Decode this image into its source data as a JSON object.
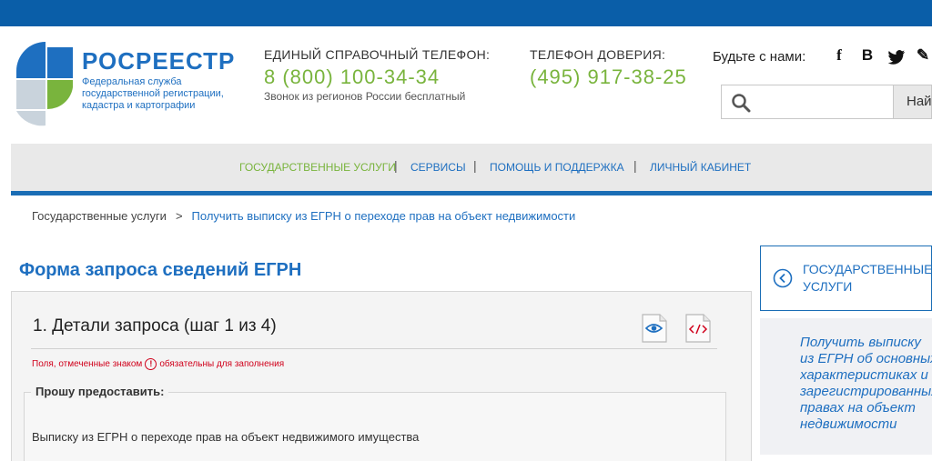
{
  "brand": {
    "title": "РОСРЕЕСТР",
    "subtitle_lines": [
      "Федеральная служба",
      "государственной регистрации,",
      "кадастра и картографии"
    ]
  },
  "contacts": {
    "hotline_label": "ЕДИНЫЙ СПРАВОЧНЫЙ ТЕЛЕФОН:",
    "hotline_number": "8 (800) 100-34-34",
    "hotline_note": "Звонок из регионов России бесплатный",
    "trust_label": "ТЕЛЕФОН ДОВЕРИЯ:",
    "trust_number": "(495) 917-38-25"
  },
  "social": {
    "label": "Будьте с нами:",
    "icons": [
      "facebook-icon",
      "vk-icon",
      "twitter-icon",
      "blog-icon"
    ],
    "glyphs": [
      "f",
      "B",
      "t",
      "✎"
    ]
  },
  "search": {
    "placeholder": "",
    "button_label": "Найти"
  },
  "nav": {
    "items": [
      {
        "label": "ГОСУДАРСТВЕННЫЕ УСЛУГИ",
        "active": true
      },
      {
        "label": "СЕРВИСЫ",
        "active": false
      },
      {
        "label": "ПОМОЩЬ И ПОДДЕРЖКА",
        "active": false
      },
      {
        "label": "ЛИЧНЫЙ КАБИНЕТ",
        "active": false
      }
    ],
    "separator": "|"
  },
  "breadcrumb": {
    "home": "Государственные услуги",
    "separator": ">",
    "current": "Получить выписку из ЕГРН о переходе прав на объект недвижимости"
  },
  "form": {
    "title": "Форма запроса сведений ЕГРН",
    "step_title": "1. Детали запроса (шаг 1 из 4)",
    "required_note_before": "Поля, отмеченные знаком",
    "required_mark": "!",
    "required_note_after": "обязательны для заполнения",
    "section_legend": "Прошу предоставить:",
    "option_text": "Выписку из ЕГРН о переходе прав на объект недвижимого имущества"
  },
  "sidebar": {
    "back_label_lines": [
      "ГОСУДАРСТВЕННЫЕ",
      "УСЛУГИ"
    ],
    "related_lines": [
      "Получить выписку",
      "из ЕГРН об основных",
      "характеристиках и",
      "зарегистрированных",
      "правах на объект",
      "недвижимости"
    ]
  },
  "colors": {
    "brand_blue": "#1e6fc0",
    "top_bar": "#0a5ea8",
    "phone_green": "#79b43d",
    "required_red": "#d0011b"
  }
}
